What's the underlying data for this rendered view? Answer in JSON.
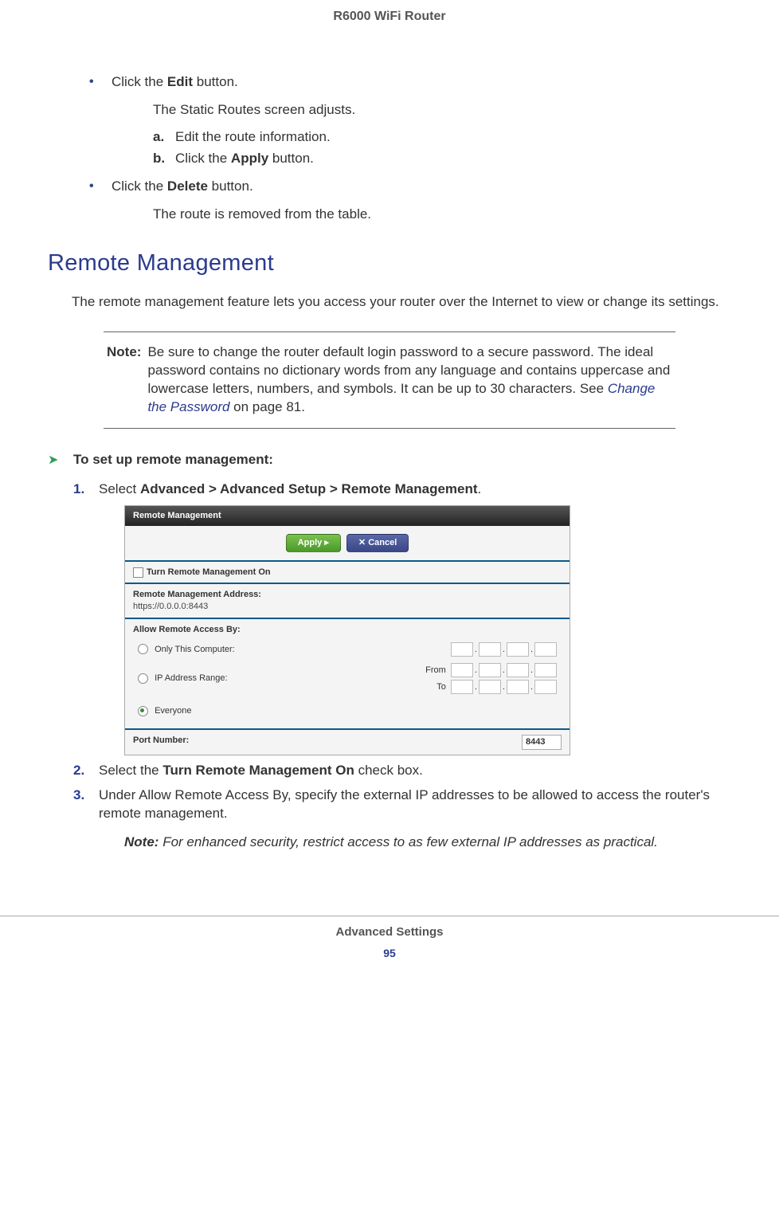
{
  "header": {
    "title": "R6000 WiFi Router"
  },
  "intro": {
    "bullets": [
      {
        "prefix": "Click the ",
        "bold": "Edit",
        "suffix": " button.",
        "sub_text": "The Static Routes screen adjusts.",
        "sub_steps": [
          {
            "letter": "a.",
            "text": "Edit the route information."
          },
          {
            "letter": "b.",
            "prefix": "Click the ",
            "bold": "Apply",
            "suffix": " button."
          }
        ]
      },
      {
        "prefix": "Click the ",
        "bold": "Delete",
        "suffix": " button.",
        "sub_text": "The route is removed from the table."
      }
    ]
  },
  "section_heading": "Remote Management",
  "body_text": "The remote management feature lets you access your router over the Internet to view or change its settings.",
  "note": {
    "label": "Note:",
    "text_before_link": "Be sure to change the router default login password to a secure password. The ideal password contains no dictionary words from any language and contains uppercase and lowercase letters, numbers, and symbols. It can be up to 30 characters. See ",
    "link_text": "Change the Password",
    "text_after_link": " on page 81."
  },
  "procedure": {
    "title": "To set up remote management:",
    "steps": [
      {
        "num": "1.",
        "prefix": "Select ",
        "bold": "Advanced > Advanced Setup > Remote Management",
        "suffix": "."
      },
      {
        "num": "2.",
        "prefix": "Select the ",
        "bold": "Turn Remote Management On",
        "suffix": " check box."
      },
      {
        "num": "3.",
        "text": "Under Allow Remote Access By, specify the external IP addresses to be allowed to access the router's remote management."
      }
    ],
    "inline_note": {
      "label": "Note:",
      "text": "For enhanced security, restrict access to as few external IP addresses as practical."
    }
  },
  "screenshot": {
    "title": "Remote Management",
    "apply_label": "Apply ▸",
    "cancel_label": "✕ Cancel",
    "checkbox_label": "Turn Remote Management On",
    "addr_label": "Remote Management Address:",
    "addr_value": "https://0.0.0.0:8443",
    "allow_label": "Allow Remote Access By:",
    "opt_only": "Only This Computer:",
    "opt_range": "IP Address Range:",
    "from_label": "From",
    "to_label": "To",
    "opt_everyone": "Everyone",
    "port_label": "Port Number:",
    "port_value": "8443"
  },
  "footer": {
    "title": "Advanced Settings",
    "page": "95"
  }
}
